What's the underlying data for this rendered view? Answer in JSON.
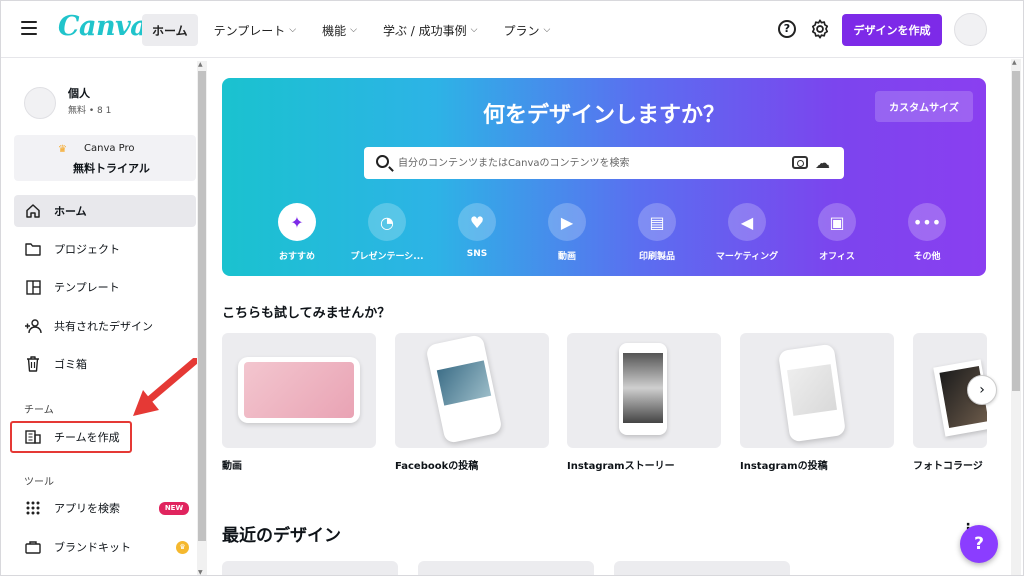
{
  "header": {
    "logo": "Canva",
    "nav": [
      {
        "label": "ホーム",
        "chev": ""
      },
      {
        "label": "テンプレート",
        "chev": "⌵"
      },
      {
        "label": "機能",
        "chev": "⌵"
      },
      {
        "label": "学ぶ / 成功事例",
        "chev": "⌵"
      },
      {
        "label": "プラン",
        "chev": "⌵"
      }
    ],
    "help_glyph": "?",
    "create_button": "デザインを作成"
  },
  "sidebar": {
    "user_name": "個人",
    "user_meta": "無料 • 8 1",
    "pro_title": "Canva Pro",
    "pro_sub": "無料トライアル",
    "items": [
      {
        "label": "ホーム",
        "icon": "home-icon"
      },
      {
        "label": "プロジェクト",
        "icon": "folder-icon"
      },
      {
        "label": "テンプレート",
        "icon": "template-icon"
      },
      {
        "label": "共有されたデザイン",
        "icon": "shared-icon"
      },
      {
        "label": "ゴミ箱",
        "icon": "trash-icon"
      }
    ],
    "team_section": "チーム",
    "team_item": "チームを作成",
    "tools_section": "ツール",
    "tools": [
      {
        "label": "アプリを検索",
        "icon": "apps-icon"
      },
      {
        "label": "ブランドキット",
        "icon": "brand-kit-icon"
      }
    ],
    "new_badge": "NEW"
  },
  "hero": {
    "title": "何をデザインしますか？",
    "custom_size": "カスタムサイズ",
    "search_placeholder": "自分のコンテンツまたはCanvaのコンテンツを検索",
    "categories": [
      {
        "label": "おすすめ",
        "glyph": "✦"
      },
      {
        "label": "プレゼンテーシ...",
        "glyph": "◔"
      },
      {
        "label": "SNS",
        "glyph": "♥"
      },
      {
        "label": "動画",
        "glyph": "▶"
      },
      {
        "label": "印刷製品",
        "glyph": "▤"
      },
      {
        "label": "マーケティング",
        "glyph": "◀"
      },
      {
        "label": "オフィス",
        "glyph": "▣"
      },
      {
        "label": "その他",
        "glyph": "•••"
      }
    ]
  },
  "try": {
    "title": "こちらも試してみませんか？",
    "cards": [
      {
        "label": "動画"
      },
      {
        "label": "Facebookの投稿"
      },
      {
        "label": "Instagramストーリー"
      },
      {
        "label": "Instagramの投稿"
      },
      {
        "label": "フォトコラージ"
      }
    ],
    "next_glyph": "›"
  },
  "recent": {
    "title": "最近のデザイン",
    "more_glyph": "⋮"
  },
  "help_fab": "?"
}
